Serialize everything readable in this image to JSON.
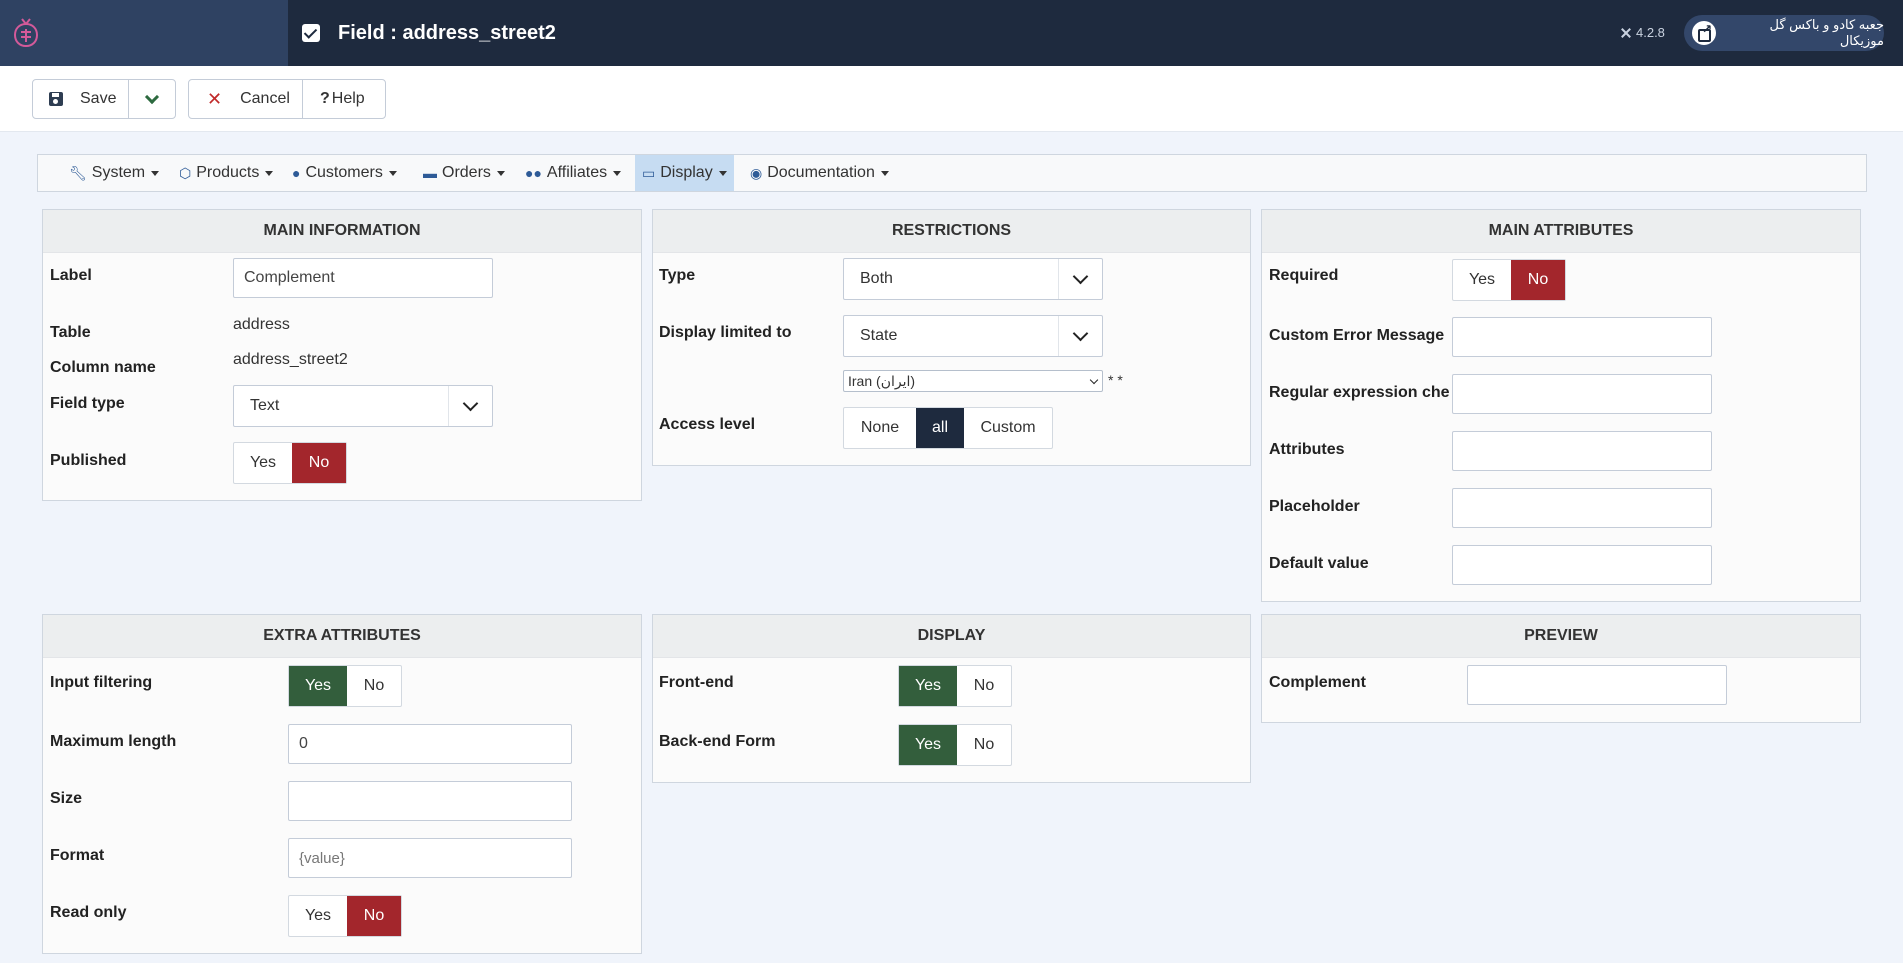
{
  "header": {
    "title": "Field : address_street2",
    "version": "4.2.8",
    "site_name": "جعبه کادو و باکس گل موزیکال"
  },
  "toolbar": {
    "save_label": "Save",
    "cancel_label": "Cancel",
    "help_label": "Help"
  },
  "menu": {
    "items": [
      {
        "label": "System"
      },
      {
        "label": "Products"
      },
      {
        "label": "Customers"
      },
      {
        "label": "Orders"
      },
      {
        "label": "Affiliates"
      },
      {
        "label": "Display"
      },
      {
        "label": "Documentation"
      }
    ]
  },
  "main_information": {
    "heading": "MAIN INFORMATION",
    "label_label": "Label",
    "label_value": "Complement",
    "table_label": "Table",
    "table_value": "address",
    "column_label": "Column name",
    "column_value": "address_street2",
    "fieldtype_label": "Field type",
    "fieldtype_value": "Text",
    "published_label": "Published",
    "yes": "Yes",
    "no": "No"
  },
  "restrictions": {
    "heading": "RESTRICTIONS",
    "type_label": "Type",
    "type_value": "Both",
    "limited_label": "Display limited to",
    "limited_value": "State",
    "country_value": "Iran (ایران)",
    "stars": "* *",
    "access_label": "Access level",
    "access_none": "None",
    "access_all": "all",
    "access_custom": "Custom"
  },
  "main_attributes": {
    "heading": "MAIN ATTRIBUTES",
    "required_label": "Required",
    "yes": "Yes",
    "no": "No",
    "error_label": "Custom Error Message",
    "regex_label": "Regular expression che...",
    "attributes_label": "Attributes",
    "placeholder_label": "Placeholder",
    "default_label": "Default value"
  },
  "extra_attributes": {
    "heading": "EXTRA ATTRIBUTES",
    "filtering_label": "Input filtering",
    "maxlen_label": "Maximum length",
    "maxlen_value": "0",
    "size_label": "Size",
    "format_label": "Format",
    "format_placeholder": "{value}",
    "readonly_label": "Read only",
    "yes": "Yes",
    "no": "No"
  },
  "display": {
    "heading": "DISPLAY",
    "frontend_label": "Front-end",
    "backend_label": "Back-end Form",
    "yes": "Yes",
    "no": "No"
  },
  "preview": {
    "heading": "PREVIEW",
    "complement_label": "Complement"
  }
}
